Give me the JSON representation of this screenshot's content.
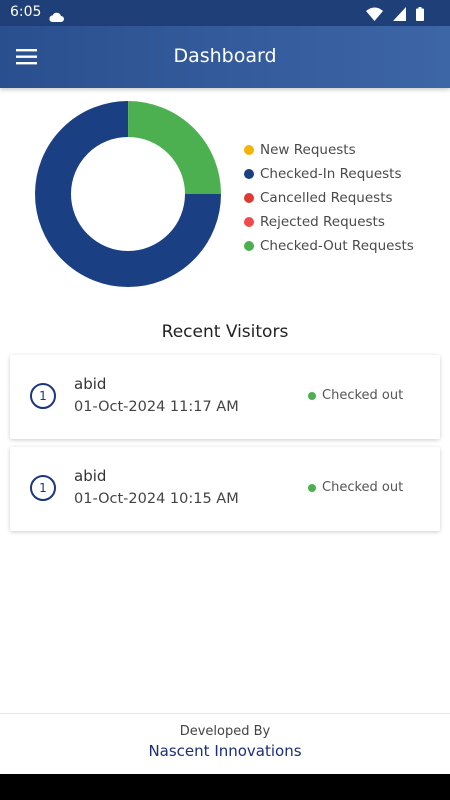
{
  "status_bar": {
    "time": "6:05",
    "icons": [
      "cloud-icon",
      "wifi-icon",
      "signal-icon",
      "battery-icon"
    ]
  },
  "app_bar": {
    "title": "Dashboard",
    "menu_icon": "hamburger-menu-icon"
  },
  "chart_data": {
    "type": "pie",
    "style": "donut",
    "series": [
      {
        "name": "New Requests",
        "value": 0,
        "color": "#f5b400"
      },
      {
        "name": "Checked-In Requests",
        "value": 0.75,
        "color": "#1a3f83"
      },
      {
        "name": "Cancelled Requests",
        "value": 0,
        "color": "#e03a30"
      },
      {
        "name": "Rejected Requests",
        "value": 0,
        "color": "#ef4b4b"
      },
      {
        "name": "Checked-Out Requests",
        "value": 0.25,
        "color": "#4caf50"
      }
    ],
    "legend_placement": "right"
  },
  "recent": {
    "title": "Recent Visitors",
    "visitors": [
      {
        "badge": "1",
        "name": "abid",
        "time": "01-Oct-2024 11:17 AM",
        "status": "Checked out",
        "status_color": "#4caf50"
      },
      {
        "badge": "1",
        "name": "abid",
        "time": "01-Oct-2024 10:15 AM",
        "status": "Checked out",
        "status_color": "#4caf50"
      }
    ]
  },
  "footer": {
    "label": "Developed By",
    "company": "Nascent Innovations"
  },
  "colors": {
    "primary": "#2a4f8f",
    "status_bar": "#1f3f78",
    "accent_text": "#1a2f78"
  }
}
